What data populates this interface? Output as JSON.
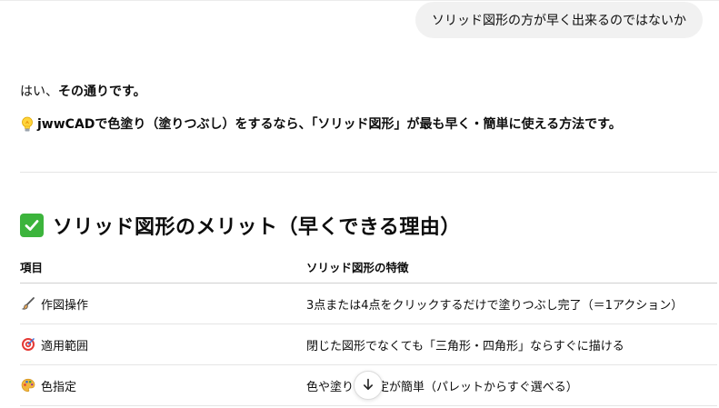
{
  "user_message": "ソリッド図形の方が早く出来るのではないか",
  "answer": {
    "intro_plain": "はい、",
    "intro_bold": "その通りです。",
    "line2_bold": "jwwCADで色塗り（塗りつぶし）をするなら、「ソリッド図形」が最も早く・簡単に使える方法です。"
  },
  "section": {
    "heading": "ソリッド図形のメリット（早くできる理由）",
    "icon": "check-mark-button-icon"
  },
  "table": {
    "headers": [
      "項目",
      "ソリッド図形の特徴"
    ],
    "rows": [
      {
        "icon": "paintbrush-icon",
        "item": "作図操作",
        "feature": "3点または4点をクリックするだけで塗りつぶし完了（＝1アクション）"
      },
      {
        "icon": "target-icon",
        "item": "適用範囲",
        "feature": "閉じた図形でなくても「三角形・四角形」ならすぐに描ける"
      },
      {
        "icon": "palette-icon",
        "item": "色指定",
        "feature": "色や塗りの設定が簡単（パレットからすぐ選べる）"
      }
    ]
  },
  "colors": {
    "accent_check": "#3cb43c",
    "bubble_bg": "#f1f1f1"
  }
}
